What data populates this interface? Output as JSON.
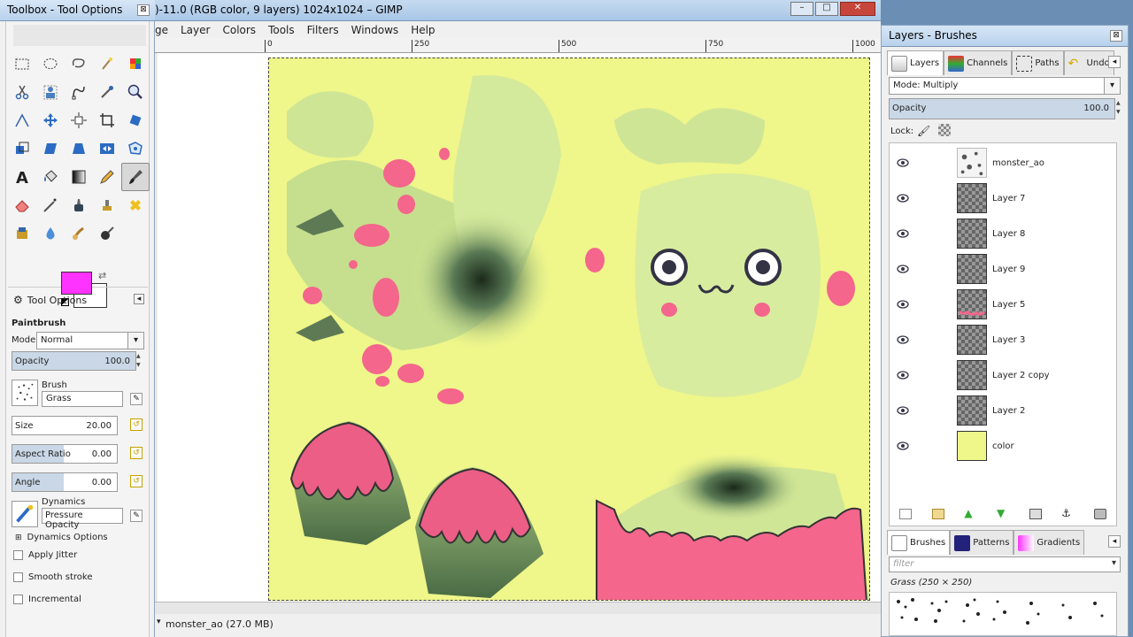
{
  "toolbox": {
    "title": "Toolbox - Tool Options",
    "close": "⊠",
    "tool_options_tab": "Tool Options",
    "tool_name": "Paintbrush",
    "mode_label": "Mode:",
    "mode_value": "Normal",
    "opacity_label": "Opacity",
    "opacity_value": "100.0",
    "opacity_fraction": 1.0,
    "brush_label": "Brush",
    "brush_value": "Grass",
    "size_label": "Size",
    "size_value": "20.00",
    "aspect_label": "Aspect Ratio",
    "aspect_value": "0.00",
    "angle_label": "Angle",
    "angle_value": "0.00",
    "dynamics_label": "Dynamics",
    "dynamics_value": "Pressure Opacity",
    "dynamics_options": "Dynamics Options",
    "apply_jitter": "Apply Jitter",
    "smooth_stroke": "Smooth stroke",
    "incremental": "Incremental",
    "fg_color": "#ff33ff",
    "bg_color": "#ffffff"
  },
  "main": {
    "title": ")-11.0 (RGB color, 9 layers) 1024x1024 – GIMP",
    "menu": [
      "ge",
      "Layer",
      "Colors",
      "Tools",
      "Filters",
      "Windows",
      "Help"
    ],
    "ruler_ticks": [
      "0",
      "250",
      "500",
      "750",
      "1000"
    ],
    "status": "monster_ao (27.0 MB)",
    "window_controls": [
      "–",
      "□",
      "✕"
    ]
  },
  "dock": {
    "title": "Layers - Brushes",
    "tabs": [
      "Layers",
      "Channels",
      "Paths",
      "Undo"
    ],
    "mode_label": "Mode: Multiply",
    "opacity_label": "Opacity",
    "opacity_value": "100.0",
    "lock_label": "Lock:",
    "layers": [
      "monster_ao",
      "Layer 7",
      "Layer 8",
      "Layer 9",
      "Layer 5",
      "Layer 3",
      "Layer 2 copy",
      "Layer 2",
      "color"
    ],
    "brush_tabs": [
      "Brushes",
      "Patterns",
      "Gradients"
    ],
    "filter_placeholder": "filter",
    "brush_info": "Grass (250 × 250)"
  }
}
